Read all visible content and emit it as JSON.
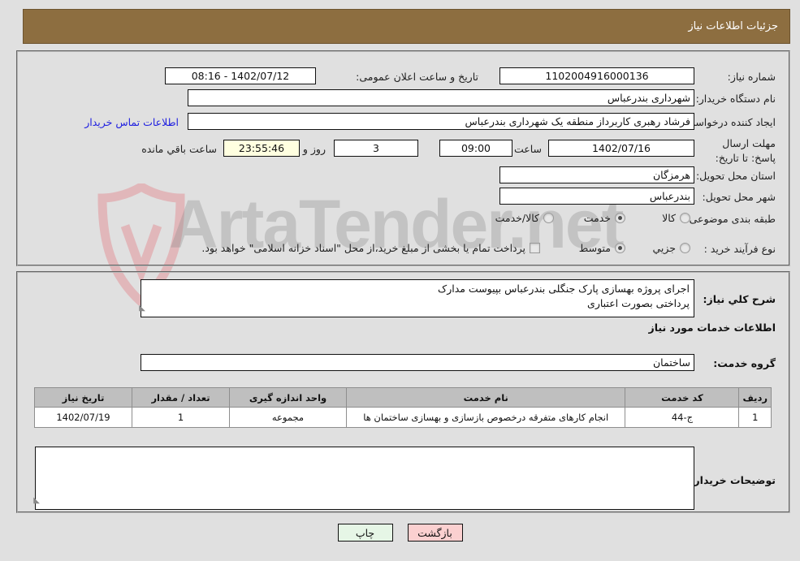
{
  "header": {
    "title": "جزئیات اطلاعات نیاز",
    "bg_color": "#8d6e40",
    "text_color": "#ffffff"
  },
  "watermark": {
    "text": "ArtaTender",
    "suffix": ".net"
  },
  "form": {
    "need_number_label": "شماره نیاز:",
    "need_number_value": "1102004916000136",
    "public_announce_label": "تاریخ و ساعت اعلان عمومی:",
    "public_announce_value": "1402/07/12 - 08:16",
    "buyer_org_label": "نام دستگاه خریدار:",
    "buyer_org_value": "شهرداری بندرعباس",
    "creator_label": "ایجاد کننده درخواست:",
    "creator_value": "فرشاد رهبری کاربرداز منطقه یک شهرداری بندرعباس",
    "contact_link": "اطلاعات تماس خریدار",
    "deadline_label": "مهلت ارسال پاسخ: تا تاریخ:",
    "deadline_date": "1402/07/16",
    "hour_label": "ساعت",
    "hour_value": "09:00",
    "days_value": "3",
    "days_unit_label": "روز و",
    "countdown_value": "23:55:46",
    "countdown_suffix_label": "ساعت باقي مانده",
    "province_label": "استان محل تحویل:",
    "province_value": "هرمزگان",
    "city_label": "شهر محل تحویل:",
    "city_value": "بندرعباس",
    "category_label": "طبقه بندی موضوعی:",
    "category_options": [
      {
        "label": "کالا",
        "selected": false
      },
      {
        "label": "خدمت",
        "selected": true
      },
      {
        "label": "کالا/خدمت",
        "selected": false
      }
    ],
    "process_label": "نوع فرآیند خرید :",
    "process_options": [
      {
        "label": "جزیي",
        "selected": false
      },
      {
        "label": "متوسط",
        "selected": true
      }
    ],
    "treasury_checkbox": {
      "label": "پرداخت تمام یا بخشی از مبلغ خرید،از محل \"اسناد خزانه اسلامی\" خواهد بود.",
      "checked": false
    }
  },
  "description": {
    "label": "شرح کلي نیاز:",
    "value": "اجرای پروژه بهسازی پارک جنگلی بندرعباس بپیوست مدارک\nپرداختی بصورت اعتباری"
  },
  "services": {
    "section_title": "اطلاعات خدمات مورد نیاز",
    "group_label": "گروه خدمت:",
    "group_value": "ساختمان",
    "columns": [
      "ردیف",
      "کد خدمت",
      "نام خدمت",
      "واحد اندازه گیری",
      "تعداد / مقدار",
      "تاریخ نیاز"
    ],
    "rows": [
      {
        "row_no": "1",
        "code": "ج-44",
        "name": "انجام کارهای متفرقه درخصوص بازسازی و بهسازی ساختمان ها",
        "unit": "مجموعه",
        "qty": "1",
        "need_date": "1402/07/19"
      }
    ]
  },
  "buyer_comments": {
    "label": "توضیحات خریدار:",
    "value": ""
  },
  "buttons": {
    "print": "چاپ",
    "back": "بازگشت"
  }
}
